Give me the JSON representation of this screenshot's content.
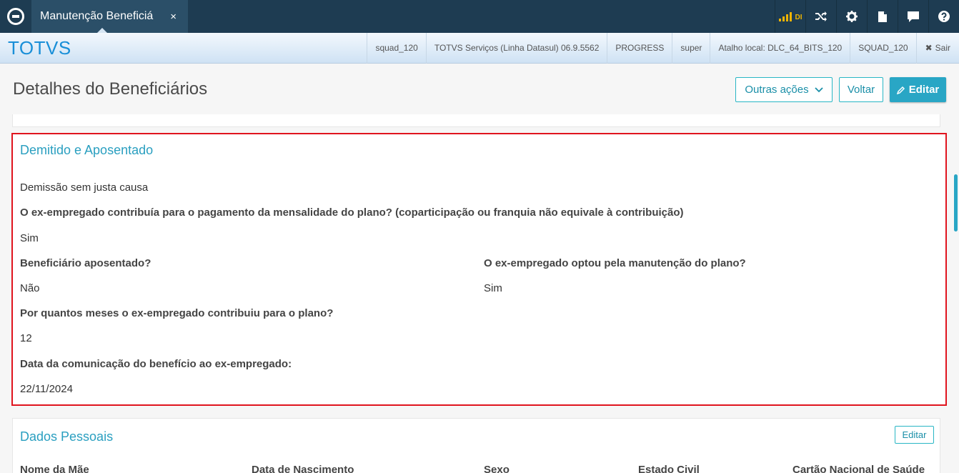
{
  "topbar": {
    "tab_label": "Manutenção Beneficiá",
    "tab_close": "×",
    "di_label": "DI"
  },
  "header": {
    "brand": "TOTVS",
    "items": [
      "squad_120",
      "TOTVS Serviços (Linha Datasul) 06.9.5562",
      "PROGRESS",
      "super",
      "Atalho local: DLC_64_BITS_120",
      "SQUAD_120"
    ],
    "logout_icon": "✖",
    "logout_label": "Sair"
  },
  "page": {
    "title": "Detalhes do Beneficiários",
    "other_actions": "Outras ações",
    "back": "Voltar",
    "edit": "Editar"
  },
  "dismissed_section": {
    "title": "Demitido e Aposentado",
    "reason_value": "Demissão sem justa causa",
    "contributed_label": "O ex-empregado contribuía para o pagamento da mensalidade do plano? (coparticipação ou franquia não equivale à contribuição)",
    "contributed_value": "Sim",
    "retired_label": "Beneficiário aposentado?",
    "retired_value": "Não",
    "kept_plan_label": "O ex-empregado optou pela manutenção do plano?",
    "kept_plan_value": "Sim",
    "months_label": "Por quantos meses o ex-empregado contribuiu para o plano?",
    "months_value": "12",
    "date_label": "Data da comunicação do benefício ao ex-empregado:",
    "date_value": "22/11/2024"
  },
  "personal_section": {
    "title": "Dados Pessoais",
    "edit": "Editar",
    "columns": [
      "Nome da Mãe",
      "Data de Nascimento",
      "Sexo",
      "Estado Civil",
      "Cartão Nacional de Saúde"
    ]
  },
  "colors": {
    "topbar": "#1e3c52",
    "accent": "#29a6c5",
    "highlight_border": "#e0141e",
    "brand": "#1a8fd8"
  }
}
